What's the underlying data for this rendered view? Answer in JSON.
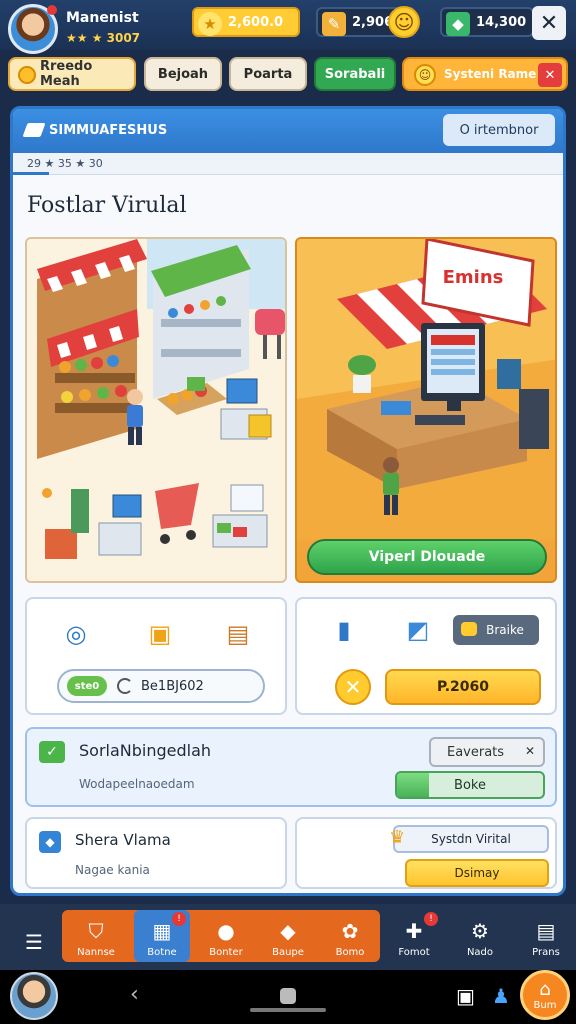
{
  "player": {
    "name": "Manenist",
    "rank": "★★ ★ 3007"
  },
  "currencies": {
    "gold": "2,600.0",
    "energy": "2,906",
    "gems": "14,300"
  },
  "tabs": [
    "Rreedo Meah",
    "Bejoah",
    "Poarta",
    "Sorabali",
    "Systeni Rame"
  ],
  "panel": {
    "header_title": "SIMMUAFESHUS",
    "header_button": "O irtembnor",
    "subbar": "29   ★   35   ★   30",
    "section_title": "Fostlar Virulal"
  },
  "scene_right": {
    "sign": "Emins",
    "button": "Viperl Dlouade"
  },
  "card_a": {
    "chip": "ste0",
    "input_value": "Be1BJ602"
  },
  "card_b": {
    "tag": "Braike",
    "button": "P.2060"
  },
  "row1": {
    "title": "SorlaNbingedlah",
    "subtitle": "Wodapeelnaoedam",
    "dropdown": "Eaverats",
    "progress_label": "Boke",
    "progress": 0.22
  },
  "card_c": {
    "title": "Shera Vlama",
    "subtitle": "Nagae kania"
  },
  "card_d": {
    "tag": "Systdn Virital",
    "button": "Dsimay"
  },
  "bottom_nav": [
    "Nannse",
    "Botne",
    "Bonter",
    "Baupe",
    "Bomo",
    "Fomot",
    "Nado",
    "Prans"
  ],
  "home": {
    "label": "Bum"
  },
  "colors": {
    "accent_blue": "#2f78c9",
    "accent_orange": "#e4691f",
    "accent_green": "#33a852",
    "gold": "#ffcb2f"
  }
}
